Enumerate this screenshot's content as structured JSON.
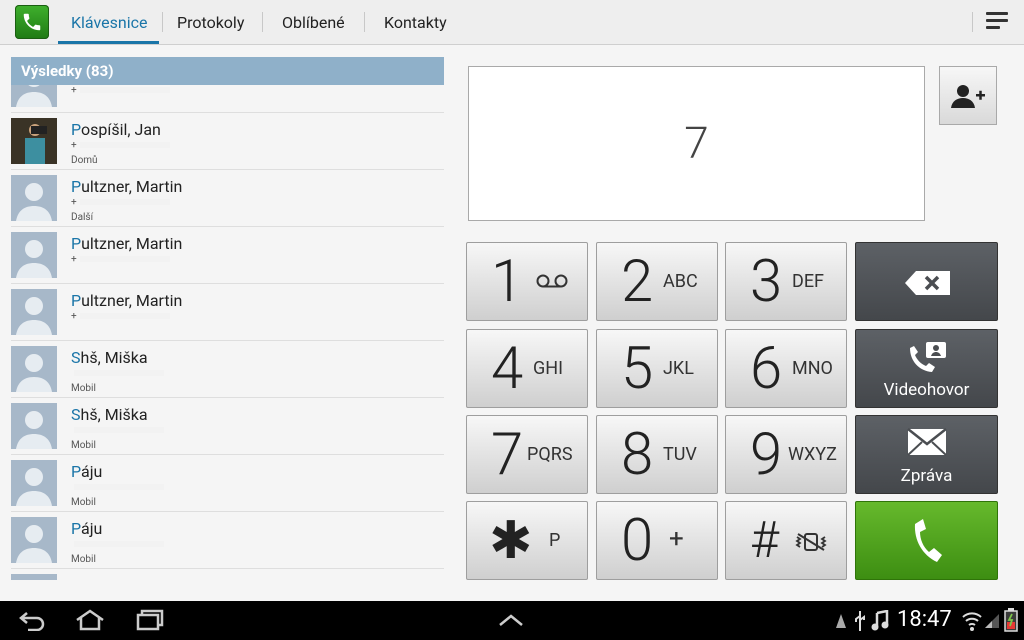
{
  "header": {
    "tabs": [
      {
        "label": "Klávesnice"
      },
      {
        "label": "Protokoly"
      },
      {
        "label": "Oblíbené"
      },
      {
        "label": "Kontakty"
      }
    ]
  },
  "results": {
    "title": "Výsledky (83)",
    "contacts": [
      {
        "highlight": "",
        "name": "",
        "number": "+",
        "type": ""
      },
      {
        "highlight": "P",
        "name": "ospíšil, Jan",
        "number": "+",
        "type": "Domů"
      },
      {
        "highlight": "P",
        "name": "ultzner, Martin",
        "number": "+",
        "type": "Další"
      },
      {
        "highlight": "P",
        "name": "ultzner, Martin",
        "number": "+",
        "type": ""
      },
      {
        "highlight": "P",
        "name": "ultzner, Martin",
        "number": "+",
        "type": ""
      },
      {
        "highlight": "S",
        "name": "hš, Miška",
        "number": "",
        "type": "Mobil"
      },
      {
        "highlight": "S",
        "name": "hš, Miška",
        "number": "",
        "type": "Mobil"
      },
      {
        "highlight": "P",
        "name": "áju",
        "number": "",
        "type": "Mobil"
      },
      {
        "highlight": "P",
        "name": "áju",
        "number": "",
        "type": "Mobil"
      }
    ]
  },
  "dialer": {
    "display_value": "7",
    "keys": [
      {
        "digit": "1",
        "sub": ""
      },
      {
        "digit": "2",
        "sub": "ABC"
      },
      {
        "digit": "3",
        "sub": "DEF"
      },
      {
        "digit": "4",
        "sub": "GHI"
      },
      {
        "digit": "5",
        "sub": "JKL"
      },
      {
        "digit": "6",
        "sub": "MNO"
      },
      {
        "digit": "7",
        "sub": "PQRS"
      },
      {
        "digit": "8",
        "sub": "TUV"
      },
      {
        "digit": "9",
        "sub": "WXYZ"
      },
      {
        "digit": "✱",
        "sub": "P"
      },
      {
        "digit": "0",
        "sub": "+"
      },
      {
        "digit": "#",
        "sub": ""
      }
    ],
    "videocall_label": "Videohovor",
    "message_label": "Zpráva"
  },
  "status_bar": {
    "time": "18:47"
  },
  "colors": {
    "accent": "#1a75a8",
    "call_green": "#4ea61f",
    "results_header": "#8fb0c9"
  }
}
